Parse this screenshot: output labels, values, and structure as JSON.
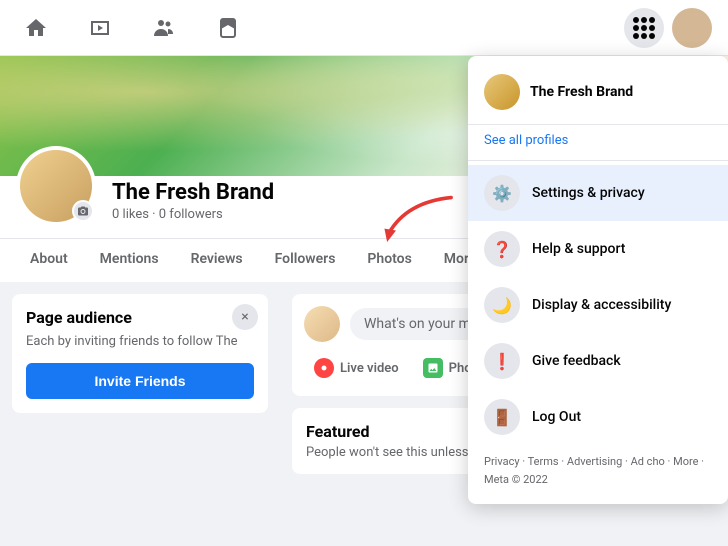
{
  "nav": {
    "home_icon": "🏠",
    "video_icon": "▶",
    "people_icon": "👥",
    "bookmark_icon": "🔖",
    "grid_icon": "grid",
    "avatar_bg": "#d4b896"
  },
  "profile": {
    "name": "The Fresh Brand",
    "stats": "0 likes · 0 followers",
    "camera_icon": "📷"
  },
  "tabs": {
    "items": [
      "About",
      "Mentions",
      "Reviews",
      "Followers",
      "Photos"
    ],
    "more_label": "More"
  },
  "left_card": {
    "title": "Page audience",
    "description": "Each by inviting friends to follow The",
    "invite_button": "Invite Friends"
  },
  "post_box": {
    "placeholder": "What's on your mind...",
    "live_label": "Live video",
    "photo_label": "Photo"
  },
  "featured": {
    "title": "Featured",
    "description": "People won't see this unless you pin something."
  },
  "dropdown": {
    "profile_name": "The Fresh Brand",
    "see_all_profiles": "See all profiles",
    "items": [
      {
        "icon": "⚙️",
        "label": "Settings & privacy",
        "active": true
      },
      {
        "icon": "❓",
        "label": "Help & support",
        "active": false
      },
      {
        "icon": "🌙",
        "label": "Display & accessibility",
        "active": false
      },
      {
        "icon": "❗",
        "label": "Give feedback",
        "active": false
      },
      {
        "icon": "🚪",
        "label": "Log Out",
        "active": false
      }
    ],
    "footer": "Privacy · Terms · Advertising · Ad cho · More · Meta © 2022"
  }
}
